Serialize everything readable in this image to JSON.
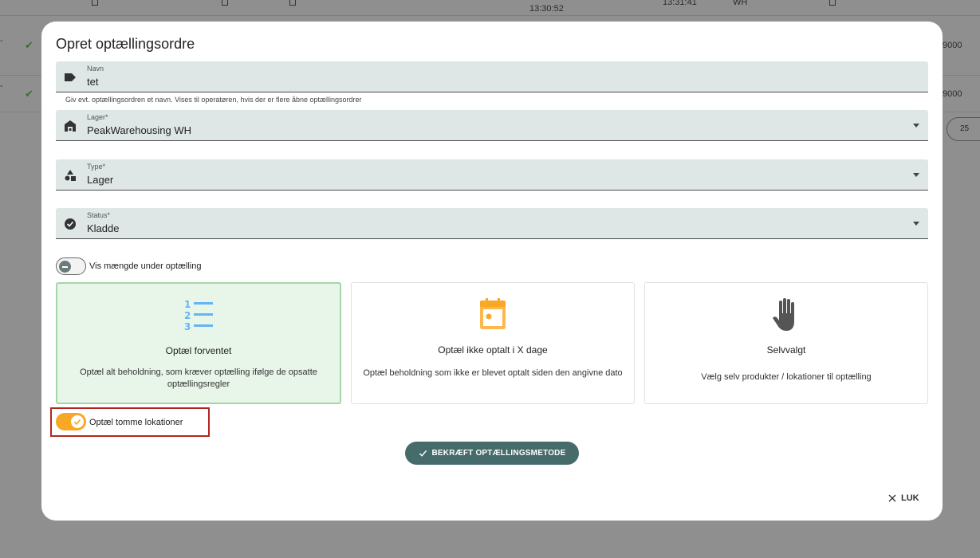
{
  "background": {
    "time_1": "13:30:52",
    "time_2": "13:31:41",
    "wh_text": "WH",
    "row_value_1": "9000",
    "row_value_2": "9000",
    "pager_value": "25",
    "dash": "-"
  },
  "modal": {
    "title": "Opret optællingsordre",
    "fields": {
      "name": {
        "label": "Navn",
        "value": "tet",
        "icon": "label-tag-icon"
      },
      "name_hint": "Giv evt. optællingsordren et navn. Vises til operatøren, hvis der er flere åbne optællingsordrer",
      "warehouse": {
        "label": "Lager*",
        "value": "PeakWarehousing WH",
        "icon": "warehouse-icon"
      },
      "type": {
        "label": "Type*",
        "value": "Lager",
        "icon": "shapes-icon"
      },
      "status": {
        "label": "Status*",
        "value": "Kladde",
        "icon": "check-circle-icon"
      }
    },
    "toggle_show_qty": {
      "label": "Vis mængde under optælling",
      "on": false
    },
    "cards": [
      {
        "title": "Optæl forventet",
        "desc": "Optæl alt beholdning, som kræver optælling ifølge de opsatte optællingsregler",
        "icon": "numbered-list-icon",
        "selected": true
      },
      {
        "title": "Optæl ikke optalt i X dage",
        "desc": "Optæl beholdning som ikke er blevet optalt siden den angivne dato",
        "icon": "calendar-icon",
        "selected": false
      },
      {
        "title": "Selvvalgt",
        "desc": "Vælg selv produkter / lokationer til optælling",
        "icon": "hand-icon",
        "selected": false
      }
    ],
    "toggle_empty_locations": {
      "label": "Optæl tomme lokationer",
      "on": true
    },
    "confirm_button": "BEKRÆFT OPTÆLLINGSMETODE",
    "close_button": "LUK"
  },
  "colors": {
    "accent": "#f9a825",
    "primary_button": "#466b6b",
    "selected_card_bg": "#e8f5e9",
    "selected_card_border": "#a5d6a7",
    "field_bg": "#dfe6e6",
    "highlight": "#b3261e"
  }
}
